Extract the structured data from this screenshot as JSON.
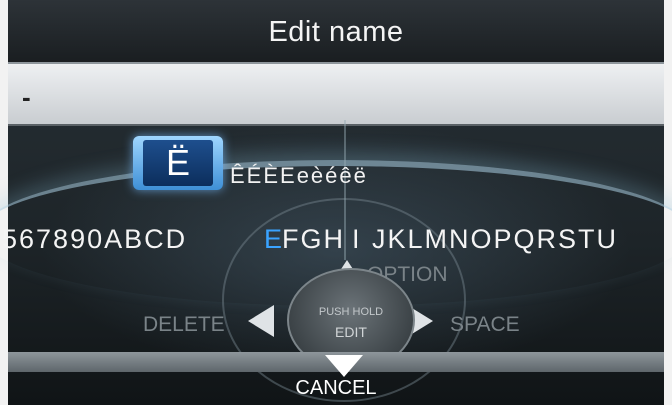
{
  "title": "Edit name",
  "name_field": {
    "value": "-"
  },
  "selected_char": "Ë",
  "accent_options": "ÊÉÈEeèéêë",
  "charset": {
    "before": "567890ABCD",
    "highlighted": "E",
    "after_1": "FGH",
    "after_2": "I",
    "after_3": "JKLMNOPQRSTU"
  },
  "dpad": {
    "line1": "PUSH HOLD",
    "line2": "EDIT"
  },
  "options": {
    "up": "OPTION",
    "left": "DELETE",
    "right": "SPACE",
    "down": "CANCEL"
  },
  "colors": {
    "highlight": "#3aa3ff",
    "selected_key": "#1e4f8e"
  }
}
